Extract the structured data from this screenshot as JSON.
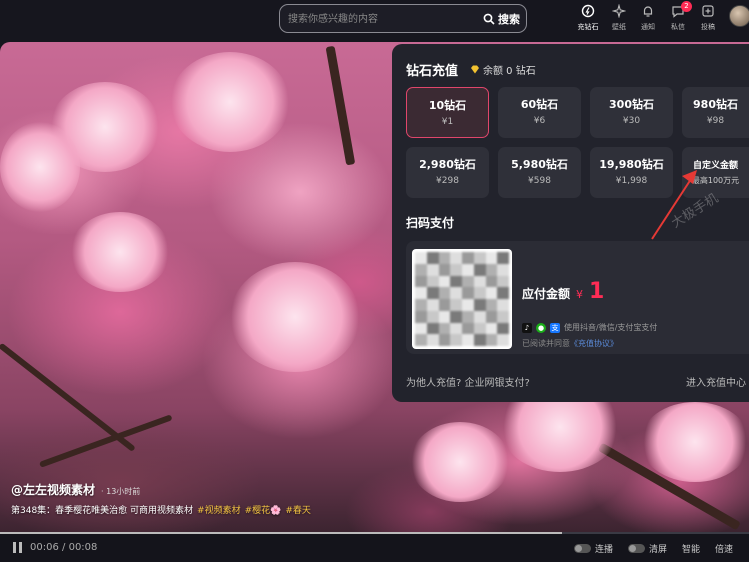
{
  "search": {
    "placeholder": "搜索你感兴趣的内容",
    "button": "搜索"
  },
  "nav": {
    "items": [
      {
        "label": "充钻石",
        "icon": "diamond-coin-icon"
      },
      {
        "label": "壁纸",
        "icon": "wallpaper-icon"
      },
      {
        "label": "通知",
        "icon": "bell-icon"
      },
      {
        "label": "私信",
        "icon": "message-icon",
        "badge": "2"
      },
      {
        "label": "投稿",
        "icon": "upload-icon"
      }
    ]
  },
  "recharge": {
    "title": "钻石充值",
    "balance": "余额 0 钻石",
    "packages": [
      {
        "amount": "10钻石",
        "price": "¥1"
      },
      {
        "amount": "60钻石",
        "price": "¥6"
      },
      {
        "amount": "300钻石",
        "price": "¥30"
      },
      {
        "amount": "980钻石",
        "price": "¥98"
      },
      {
        "amount": "2,980钻石",
        "price": "¥298"
      },
      {
        "amount": "5,980钻石",
        "price": "¥598"
      },
      {
        "amount": "19,980钻石",
        "price": "¥1,998"
      },
      {
        "amount": "自定义金额",
        "price": "最高100万元"
      }
    ],
    "scan_title": "扫码支付",
    "pay_label": "应付金额",
    "currency": "¥",
    "pay_value": "1",
    "methods_text": "使用抖音/微信/支付宝支付",
    "agree_text": "已阅读并同意",
    "agree_link": "《充值协议》",
    "help_link": "为他人充值? 企业网银支付?",
    "center_link": "进入充值中心"
  },
  "watermark": "大极手机",
  "video": {
    "author": "@左左视频素材",
    "time": "· 13小时前",
    "caption": "第348集：春季樱花唯美治愈 可商用视频素材",
    "tags": [
      "#视频素材",
      "#樱花🌸",
      "#春天"
    ],
    "current_time": "00:06",
    "separator": "/",
    "duration": "00:08",
    "progress": 0.75,
    "controls": [
      "连播",
      "清屏",
      "智能",
      "倍速"
    ]
  },
  "colors": {
    "accent": "#fe2c55",
    "tag": "#f4c542",
    "link": "#5b8bd9"
  }
}
